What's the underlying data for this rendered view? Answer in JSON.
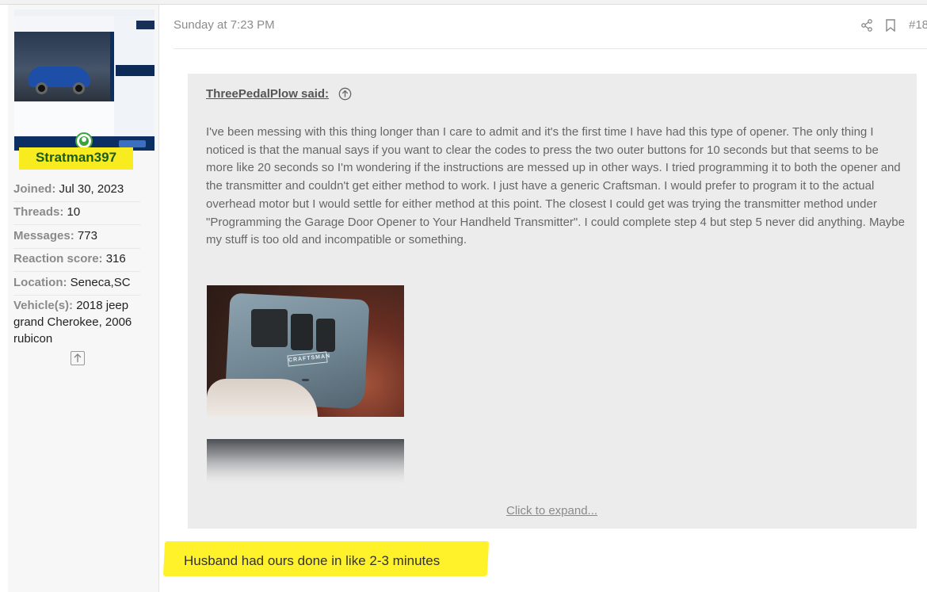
{
  "user": {
    "name": "Stratman397",
    "stats": [
      {
        "label": "Joined:",
        "value": "Jul 30, 2023"
      },
      {
        "label": "Threads:",
        "value": "10"
      },
      {
        "label": "Messages:",
        "value": "773"
      },
      {
        "label": "Reaction score:",
        "value": "316"
      },
      {
        "label": "Location:",
        "value": "Seneca,SC"
      },
      {
        "label": "Vehicle(s):",
        "value": "2018 jeep grand Cherokee, 2006 rubicon"
      }
    ]
  },
  "post": {
    "date": "Sunday at 7:23 PM",
    "number": "#18"
  },
  "quote": {
    "author": "ThreePedalPlow said:",
    "text": "I've been messing with this thing longer than I care to admit and it's the first time I have had this type of opener. The only thing I noticed is that the manual says if you want to clear the codes to press the two outer buttons for 10 seconds but that seems to be more like 20 seconds so I'm wondering if the instructions are messed up in other ways. I tried programming it to both the opener and the transmitter and couldn't get either method to work. I just have a generic Craftsman. I would prefer to program it to the actual overhead motor but I would settle for either method at this point. The closest I could get was trying the transmitter method under \"Programming the Garage Door Opener to Your Handheld Transmitter\". I could complete step 4 but step 5 never did anything. Maybe my stuff is too old and incompatible or something.",
    "expand": "Click to expand...",
    "remote_label": "CRAFTSMAN"
  },
  "reply": {
    "text": "Husband had ours done in like 2-3 minutes"
  },
  "colors": {
    "highlight": "#f8ec21",
    "username": "#1a5c1a",
    "quote_bg": "#ececec"
  }
}
